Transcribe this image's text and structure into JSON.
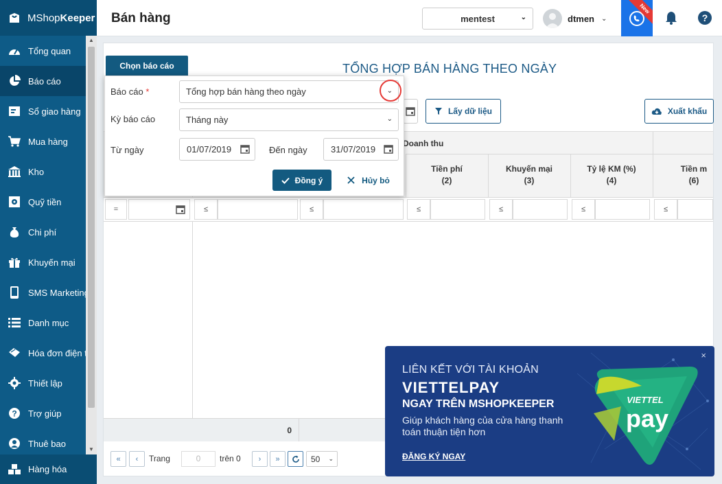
{
  "app": {
    "logo_prefix": "MShop",
    "logo_bold": "Keeper"
  },
  "sidebar": {
    "items": [
      {
        "label": "Tổng quan",
        "icon": "dashboard-icon"
      },
      {
        "label": "Báo cáo",
        "icon": "pie-chart-icon",
        "active": true
      },
      {
        "label": "Sổ giao hàng",
        "icon": "delivery-icon"
      },
      {
        "label": "Mua hàng",
        "icon": "cart-icon"
      },
      {
        "label": "Kho",
        "icon": "warehouse-icon"
      },
      {
        "label": "Quỹ tiền",
        "icon": "safe-icon"
      },
      {
        "label": "Chi phí",
        "icon": "money-bag-icon"
      },
      {
        "label": "Khuyến mại",
        "icon": "gift-icon"
      },
      {
        "label": "SMS Marketing",
        "icon": "phone-icon"
      },
      {
        "label": "Danh mục",
        "icon": "list-icon"
      },
      {
        "label": "Hóa đơn điện t",
        "icon": "invoice-icon"
      },
      {
        "label": "Thiết lập",
        "icon": "gear-icon"
      },
      {
        "label": "Trợ giúp",
        "icon": "help-icon"
      },
      {
        "label": "Thuê bao",
        "icon": "user-icon"
      }
    ],
    "bottom": {
      "label": "Hàng hóa",
      "icon": "boxes-icon"
    }
  },
  "header": {
    "title": "Bán hàng",
    "store": "mentest",
    "user": "dtmen",
    "new_badge": "New"
  },
  "report": {
    "choose_tab": "Chọn báo cáo",
    "title": "TỔNG HỢP BÁN HÀNG THEO NGÀY",
    "get_data": "Lấy dữ liệu",
    "export": "Xuất khẩu"
  },
  "table": {
    "group_header": "Doanh thu",
    "columns": [
      {
        "label": "Tiền phí",
        "num": "(2)"
      },
      {
        "label": "Khuyến mại",
        "num": "(3)"
      },
      {
        "label": "Tỷ lệ KM (%)",
        "num": "(4)"
      },
      {
        "label": "Tiền m",
        "num": "(6)"
      }
    ],
    "filter_ops": [
      "=",
      "≤",
      "≤",
      "≤",
      "≤",
      "≤",
      "≤"
    ],
    "footer_total": "0"
  },
  "pager": {
    "page_label": "Trang",
    "page_value": "0",
    "of_label": "trên 0",
    "page_size": "50"
  },
  "dialog": {
    "report_label": "Báo cáo",
    "report_required": "*",
    "report_value": "Tổng hợp bán hàng theo ngày",
    "period_label": "Kỳ báo cáo",
    "period_value": "Tháng này",
    "from_label": "Từ ngày",
    "from_value": "01/07/2019",
    "to_label": "Đến ngày",
    "to_value": "31/07/2019",
    "ok": "Đồng ý",
    "cancel": "Hủy bỏ"
  },
  "promo": {
    "line1": "LIÊN KẾT VỚI TÀI KHOẢN",
    "line2": "VIETTELPAY",
    "line3": "NGAY TRÊN MSHOPKEEPER",
    "line4": "Giúp khách hàng của cửa hàng thanh toán thuận tiện hơn",
    "cta": "ĐĂNG KÝ NGAY",
    "logo_top": "VIETTEL",
    "logo_bottom": "pay",
    "close": "×"
  },
  "colors": {
    "sidebar": "#0e5b87",
    "primary": "#135a80",
    "accent_blue": "#1a73e8",
    "promo_bg": "#1b3d84",
    "highlight_red": "#e53935"
  }
}
